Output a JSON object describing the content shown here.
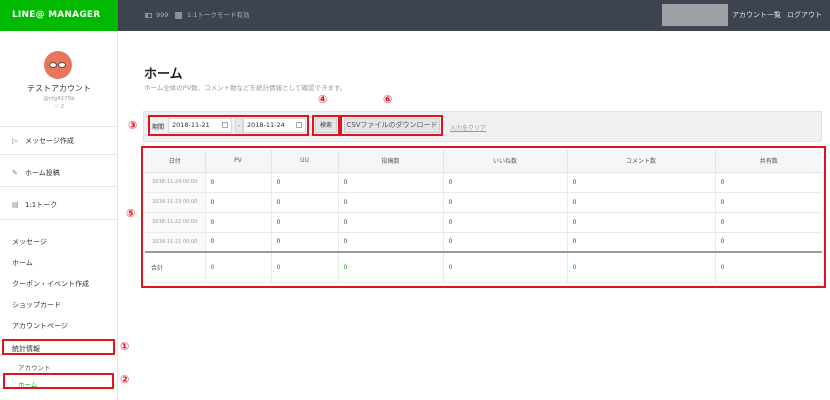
{
  "header": {
    "logo": "LINE@ MANAGER",
    "friends": "999",
    "mode": "1:1トークモード有効",
    "account_list": "アカウント一覧",
    "logout": "ログアウト"
  },
  "account": {
    "name": "テストアカウント",
    "id": "@cfg4175b",
    "count": "2"
  },
  "sidebar": {
    "actions": [
      {
        "label": "メッセージ作成",
        "icon": "megaphone-icon"
      },
      {
        "label": "ホーム投稿",
        "icon": "edit-icon"
      },
      {
        "label": "1:1トーク",
        "icon": "chat-icon"
      }
    ],
    "menu": [
      "メッセージ",
      "ホーム",
      "クーポン・イベント作成",
      "ショップカード",
      "アカウントページ",
      "統計情報"
    ],
    "sub": [
      "アカウント",
      "ホーム"
    ]
  },
  "main": {
    "title": "ホーム",
    "description": "ホーム全体のPV数、コメント数などを統計情報として確認できます。",
    "period_label": "期間",
    "date_from": "2018-11-21",
    "date_to": "2018-11-24",
    "dash": "-",
    "search_button": "検索",
    "csv_button": "CSVファイルのダウンロード",
    "clear_link": "入力をクリア"
  },
  "table": {
    "headers": [
      "日付",
      "PV",
      "UU",
      "投稿数",
      "いいね数",
      "コメント数",
      "共有数"
    ],
    "rows": [
      [
        "2018-11-24 00:00",
        "0",
        "0",
        "0",
        "0",
        "0",
        "0"
      ],
      [
        "2018-11-23 00:00",
        "0",
        "0",
        "0",
        "0",
        "0",
        "0"
      ],
      [
        "2018-11-22 00:00",
        "0",
        "0",
        "0",
        "0",
        "0",
        "0"
      ],
      [
        "2018-11-21 00:00",
        "0",
        "0",
        "0",
        "0",
        "0",
        "0"
      ]
    ],
    "total": [
      "合計",
      "0",
      "0",
      "0",
      "0",
      "0",
      "0"
    ]
  },
  "annotations": [
    "①",
    "②",
    "③",
    "④",
    "⑤",
    "⑥"
  ],
  "colors": {
    "brand": "#00b900",
    "topbar": "#3d4450",
    "annotation": "#e0141e"
  }
}
